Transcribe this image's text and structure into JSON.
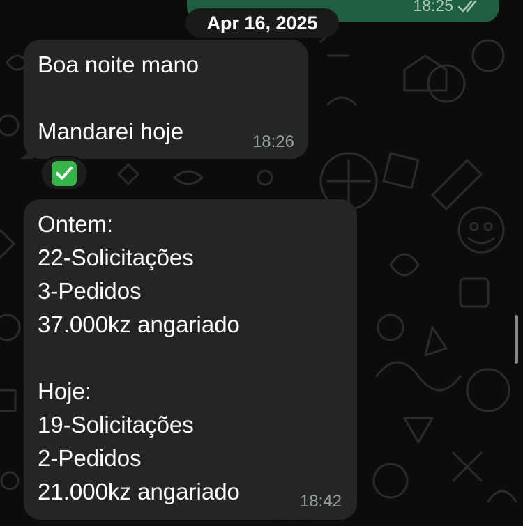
{
  "chat": {
    "date_separator": "Apr 16, 2025",
    "outgoing_top": {
      "time": "18:25",
      "status": "read"
    },
    "messages": [
      {
        "lines": "Boa noite mano\n\nMandarei hoje",
        "time": "18:26",
        "reaction": "✅"
      },
      {
        "lines": "Ontem:\n22-Solicitações\n3-Pedidos\n37.000kz angariado\n\nHoje:\n19-Solicitações\n2-Pedidos\n21.000kz angariado",
        "time": "18:42"
      }
    ]
  },
  "colors": {
    "background": "#0b0c0c",
    "incoming_bubble": "#242626",
    "outgoing_bubble": "#1f5e3f",
    "date_pill": "#191a1a",
    "timestamp": "#9a9d9d",
    "check_emoji": "#38b54a"
  },
  "icons": {
    "read_receipt": "double-check-icon",
    "reaction": "check-mark-emoji-icon"
  }
}
